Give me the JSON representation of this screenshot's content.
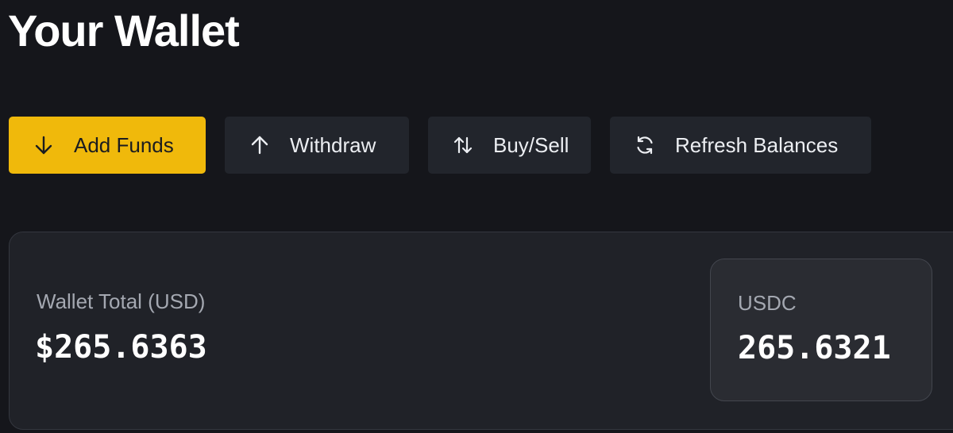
{
  "page": {
    "title": "Your Wallet"
  },
  "actions": {
    "add_funds": {
      "label": "Add Funds",
      "icon": "arrow-down-icon"
    },
    "withdraw": {
      "label": "Withdraw",
      "icon": "arrow-up-icon"
    },
    "buy_sell": {
      "label": "Buy/Sell",
      "icon": "swap-vertical-icon"
    },
    "refresh": {
      "label": "Refresh Balances",
      "icon": "refresh-icon"
    }
  },
  "wallet": {
    "total_label": "Wallet Total (USD)",
    "total_value": "$265.6363",
    "assets": [
      {
        "symbol": "USDC",
        "amount": "265.6321"
      }
    ]
  },
  "colors": {
    "background": "#15161b",
    "primary_accent": "#f0b90b",
    "button_bg": "#22252c",
    "card_bg": "#202228"
  }
}
